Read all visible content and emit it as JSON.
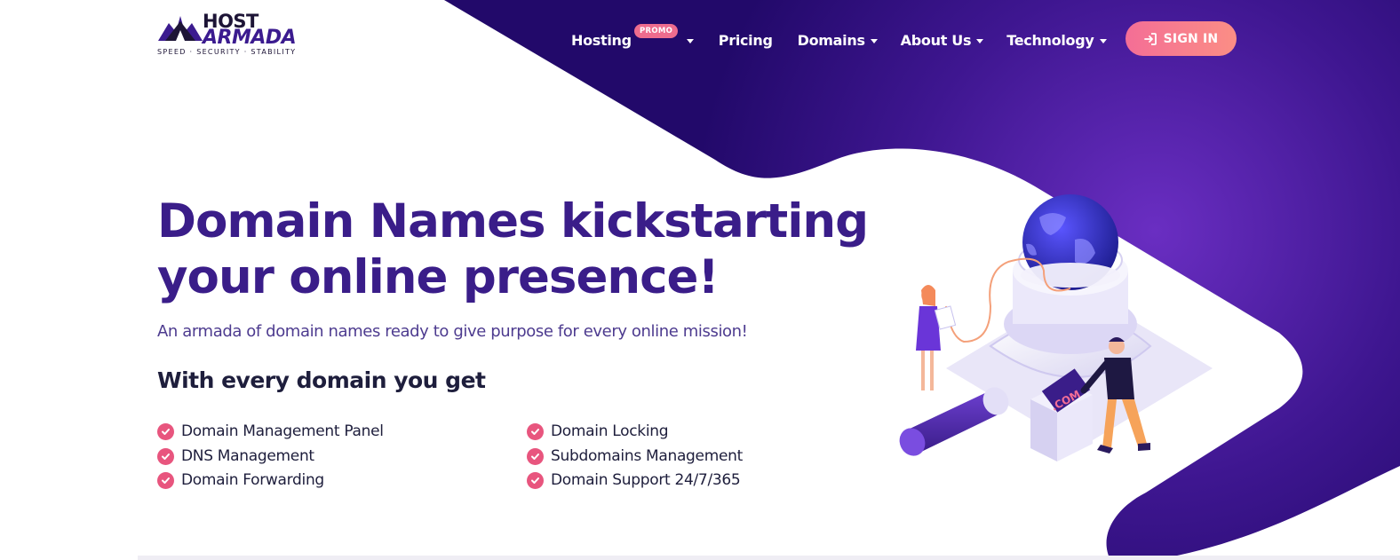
{
  "brand": {
    "name_top": "HOST",
    "name_bottom": "ARMADA",
    "tagline": "SPEED · SECURITY · STABILITY"
  },
  "nav": {
    "items": [
      {
        "label": "Hosting",
        "badge": "PROMO",
        "dropdown": true
      },
      {
        "label": "Pricing",
        "dropdown": false
      },
      {
        "label": "Domains",
        "dropdown": true
      },
      {
        "label": "About Us",
        "dropdown": true
      },
      {
        "label": "Technology",
        "dropdown": true
      }
    ],
    "signin_label": "SIGN IN"
  },
  "hero": {
    "title": "Domain Names kickstarting your online presence!",
    "subtitle": "An armada of domain names ready to give purpose for every online mission!",
    "features_heading": "With every domain you get",
    "features": [
      "Domain Management Panel",
      "DNS Management",
      "Domain Forwarding",
      "Domain Locking",
      "Subdomains Management",
      "Domain Support 24/7/365"
    ]
  },
  "illustration": {
    "box_label": ".COM"
  },
  "colors": {
    "primary": "#3a1d89",
    "dark_purple": "#2a0f6e",
    "accent_pink": "#ee6c8e",
    "check_pink": "#e8557e"
  }
}
